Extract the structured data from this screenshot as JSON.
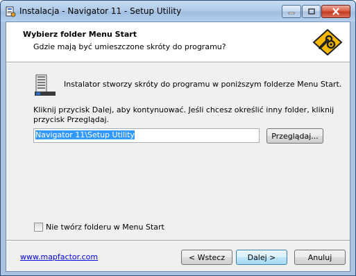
{
  "window": {
    "title": "Instalacja - Navigator 11 - Setup Utility"
  },
  "header": {
    "title": "Wybierz folder Menu Start",
    "subtitle": "Gdzie mają być umieszczone skróty do programu?"
  },
  "body": {
    "info": "Instalator stworzy skróty do programu w poniższym folderze Menu Start.",
    "hint": "Kliknij przycisk Dalej, aby kontynuować. Jeśli chcesz określić inny folder, kliknij przycisk Przeglądaj.",
    "folder_value": "Navigator 11\\Setup Utility",
    "browse_label": "Przeglądaj...",
    "no_folder_checkbox": {
      "label": "Nie twórz folderu w Menu Start",
      "checked": false
    }
  },
  "footer": {
    "link": "www.mapfactor.com",
    "back_label": "< Wstecz",
    "next_label": "Dalej >",
    "cancel_label": "Anuluj"
  },
  "icons": {
    "app": "installer-icon",
    "logo": "gear-wrench-icon",
    "folder": "program-folder-icon"
  },
  "colors": {
    "titlebar": "#b2cbe8",
    "selection": "#3399ff",
    "link": "#0000ee",
    "logo_bg": "#f5b800"
  }
}
